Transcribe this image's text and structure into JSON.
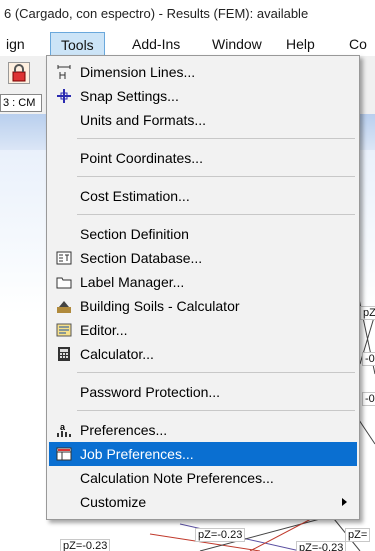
{
  "window": {
    "title": "6 (Cargado, con espectro) - Results (FEM): available"
  },
  "menubar": {
    "items": [
      "ign",
      "Tools",
      "Add-Ins",
      "Window",
      "Help",
      "Co"
    ]
  },
  "toolbar": {
    "combo_value": "3 : CM"
  },
  "canvas": {
    "labels": [
      "pZ",
      "-0",
      "-0",
      "pZ=-0.23",
      "pZ=-0.23",
      "pZ=-0.23",
      "pZ="
    ]
  },
  "tools_menu": {
    "items": [
      {
        "label": "Dimension Lines...",
        "icon": "dimension-lines-icon"
      },
      {
        "label": "Snap Settings...",
        "icon": "snap-settings-icon"
      },
      {
        "label": "Units and Formats..."
      },
      {
        "label": "Point Coordinates..."
      },
      {
        "label": "Cost Estimation..."
      },
      {
        "label": "Section Definition"
      },
      {
        "label": "Section Database...",
        "icon": "section-database-icon"
      },
      {
        "label": "Label Manager...",
        "icon": "folder-icon"
      },
      {
        "label": "Building Soils - Calculator",
        "icon": "building-soils-icon"
      },
      {
        "label": "Editor...",
        "icon": "editor-icon"
      },
      {
        "label": "Calculator...",
        "icon": "calculator-icon"
      },
      {
        "label": "Password Protection..."
      },
      {
        "label": "Preferences...",
        "icon": "preferences-icon"
      },
      {
        "label": "Job Preferences...",
        "icon": "job-preferences-icon",
        "highlighted": true
      },
      {
        "label": "Calculation Note Preferences..."
      },
      {
        "label": "Customize",
        "submenu": true
      }
    ]
  },
  "colors": {
    "highlight": "#0a6fd1",
    "menu_bg": "#f2f2f2",
    "active_menu": "#cce4f7"
  }
}
